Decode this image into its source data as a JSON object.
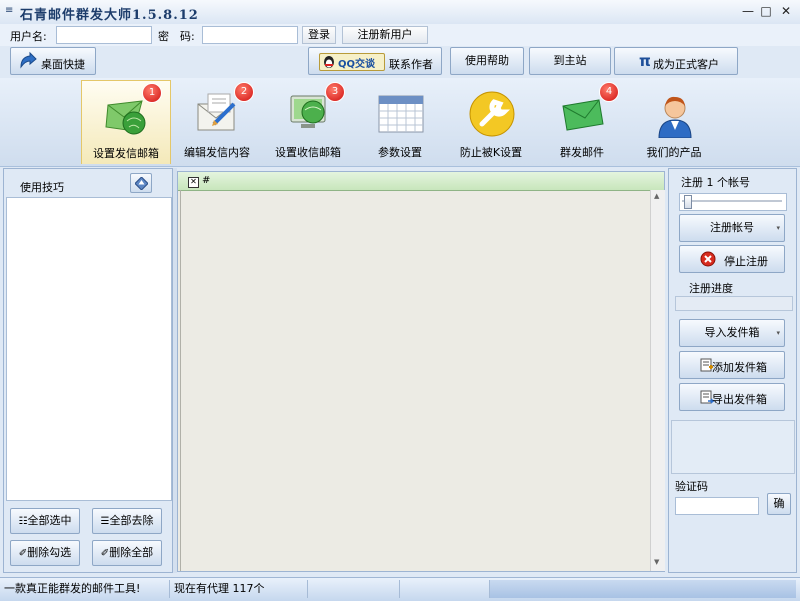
{
  "window": {
    "title": "石青邮件群发大师1.5.8.12",
    "controls": {
      "minimize": "—",
      "restore": "□",
      "close": "✕"
    }
  },
  "login": {
    "username_label": "用户名:",
    "username_value": "",
    "password_label": "密　码:",
    "password_value": "",
    "login_button": "登录",
    "register_button": "注册新用户"
  },
  "toolbar": {
    "desktop_shortcut": "桌面快捷",
    "qq_badge": "QQ交谈",
    "contact_author": "联系作者",
    "help": "使用帮助",
    "main_site": "到主站",
    "pi_symbol": "π",
    "become_customer": "成为正式客户"
  },
  "nav": {
    "tabs": [
      {
        "label": "设置发信邮箱",
        "badge": "1",
        "icon": "envelope-globe-icon",
        "active": true
      },
      {
        "label": "编辑发信内容",
        "badge": "2",
        "icon": "envelope-edit-icon",
        "active": false
      },
      {
        "label": "设置收信邮箱",
        "badge": "3",
        "icon": "monitor-globe-icon",
        "active": false
      },
      {
        "label": "参数设置",
        "badge": "",
        "icon": "calendar-grid-icon",
        "active": false
      },
      {
        "label": "防止被K设置",
        "badge": "",
        "icon": "wrench-icon",
        "active": false
      },
      {
        "label": "群发邮件",
        "badge": "4",
        "icon": "green-envelope-icon",
        "active": false
      },
      {
        "label": "我们的产品",
        "badge": "",
        "icon": "person-icon",
        "active": false
      }
    ]
  },
  "left_panel": {
    "tips_label": "使用技巧",
    "select_all": "全部选中",
    "deselect_all": "全部去除",
    "delete_checked": "删除勾选",
    "delete_all": "删除全部"
  },
  "center": {
    "column_header": "#"
  },
  "right_panel": {
    "register_count_label": "注册 1 个帐号",
    "register_account": "注册帐号",
    "stop_register": "停止注册",
    "register_progress_label": "注册进度",
    "import_outbox": "导入发件箱",
    "add_outbox": "添加发件箱",
    "export_outbox": "导出发件箱",
    "captcha_label": "验证码",
    "captcha_value": "",
    "confirm": "确"
  },
  "status": {
    "slogan": "一款真正能群发的邮件工具!",
    "proxies": "现在有代理 117个"
  }
}
